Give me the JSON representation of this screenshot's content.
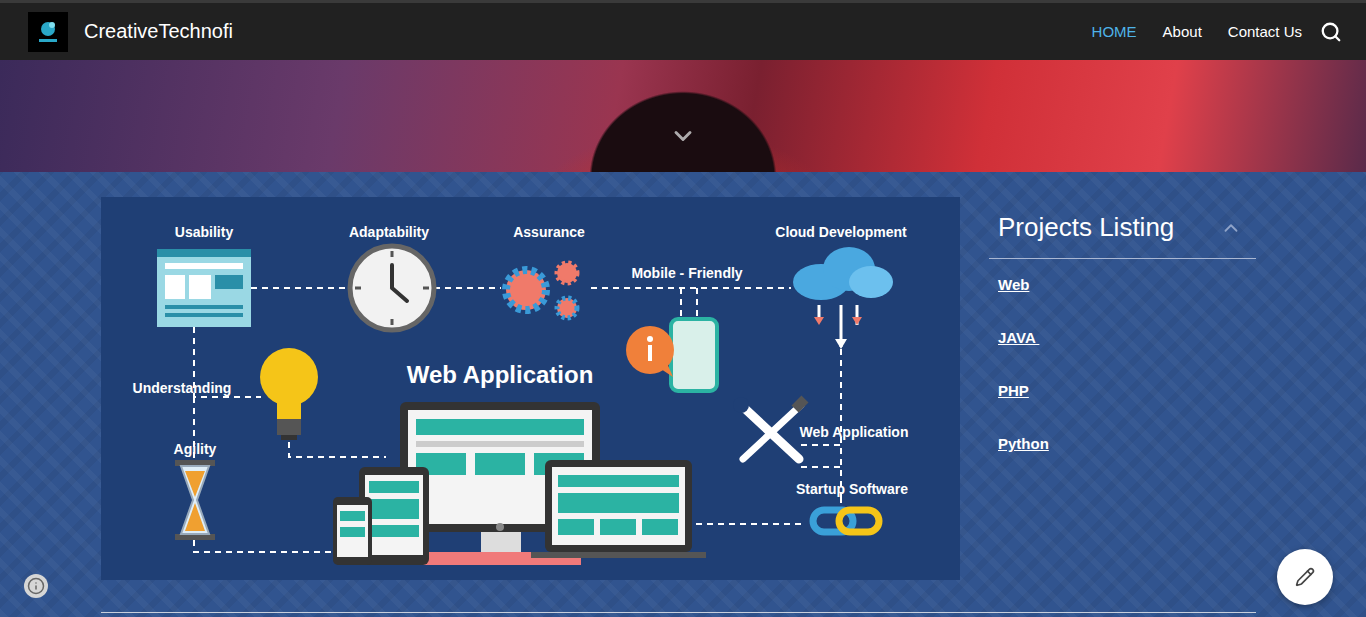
{
  "header": {
    "site_title": "CreativeTechnofi",
    "nav": [
      {
        "label": "HOME",
        "selected": true
      },
      {
        "label": "About",
        "selected": false
      },
      {
        "label": "Contact Us",
        "selected": false
      }
    ]
  },
  "infographic": {
    "title": "Web Application",
    "nodes": [
      {
        "label": "Usability"
      },
      {
        "label": "Adaptability"
      },
      {
        "label": "Assurance"
      },
      {
        "label": "Cloud Development"
      },
      {
        "label": "Mobile - Friendly"
      },
      {
        "label": "Understanding"
      },
      {
        "label": "Agility"
      },
      {
        "label": "Web Application"
      },
      {
        "label": "Startup Software"
      }
    ]
  },
  "sidebar": {
    "title": "Projects Listing",
    "expanded": true,
    "items": [
      {
        "label": "Web"
      },
      {
        "label": "JAVA "
      },
      {
        "label": "PHP"
      },
      {
        "label": "Python"
      }
    ]
  }
}
